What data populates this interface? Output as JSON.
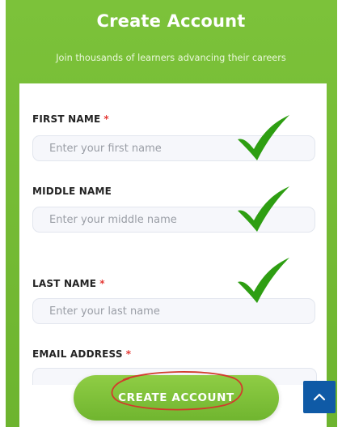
{
  "header": {
    "title": "Create Account",
    "subtitle": "Join thousands of learners advancing their careers"
  },
  "form": {
    "first_name": {
      "label": "FIRST NAME",
      "required_mark": "*",
      "placeholder": "Enter your first name",
      "value": ""
    },
    "middle_name": {
      "label": "MIDDLE NAME",
      "placeholder": "Enter your middle name",
      "value": ""
    },
    "last_name": {
      "label": "LAST NAME",
      "required_mark": "*",
      "placeholder": "Enter your last name",
      "value": ""
    },
    "email": {
      "label": "EMAIL ADDRESS",
      "required_mark": "*"
    },
    "submit_label": "CREATE ACCOUNT"
  },
  "annotations": {
    "check_color": "#2e9e12",
    "circle_color": "#d23b2c"
  },
  "theme": {
    "brand_green": "#6db42f",
    "scroll_button_color": "#0f5aa6"
  },
  "icons": {
    "checkmark": "check-icon",
    "scroll_top": "chevron-up-icon"
  }
}
